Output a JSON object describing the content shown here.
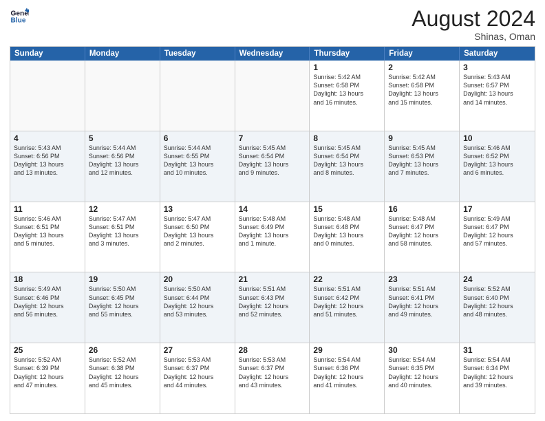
{
  "logo": {
    "line1": "General",
    "line2": "Blue"
  },
  "title": "August 2024",
  "subtitle": "Shinas, Oman",
  "days": [
    "Sunday",
    "Monday",
    "Tuesday",
    "Wednesday",
    "Thursday",
    "Friday",
    "Saturday"
  ],
  "weeks": [
    [
      {
        "day": "",
        "text": ""
      },
      {
        "day": "",
        "text": ""
      },
      {
        "day": "",
        "text": ""
      },
      {
        "day": "",
        "text": ""
      },
      {
        "day": "1",
        "text": "Sunrise: 5:42 AM\nSunset: 6:58 PM\nDaylight: 13 hours\nand 16 minutes."
      },
      {
        "day": "2",
        "text": "Sunrise: 5:42 AM\nSunset: 6:58 PM\nDaylight: 13 hours\nand 15 minutes."
      },
      {
        "day": "3",
        "text": "Sunrise: 5:43 AM\nSunset: 6:57 PM\nDaylight: 13 hours\nand 14 minutes."
      }
    ],
    [
      {
        "day": "4",
        "text": "Sunrise: 5:43 AM\nSunset: 6:56 PM\nDaylight: 13 hours\nand 13 minutes."
      },
      {
        "day": "5",
        "text": "Sunrise: 5:44 AM\nSunset: 6:56 PM\nDaylight: 13 hours\nand 12 minutes."
      },
      {
        "day": "6",
        "text": "Sunrise: 5:44 AM\nSunset: 6:55 PM\nDaylight: 13 hours\nand 10 minutes."
      },
      {
        "day": "7",
        "text": "Sunrise: 5:45 AM\nSunset: 6:54 PM\nDaylight: 13 hours\nand 9 minutes."
      },
      {
        "day": "8",
        "text": "Sunrise: 5:45 AM\nSunset: 6:54 PM\nDaylight: 13 hours\nand 8 minutes."
      },
      {
        "day": "9",
        "text": "Sunrise: 5:45 AM\nSunset: 6:53 PM\nDaylight: 13 hours\nand 7 minutes."
      },
      {
        "day": "10",
        "text": "Sunrise: 5:46 AM\nSunset: 6:52 PM\nDaylight: 13 hours\nand 6 minutes."
      }
    ],
    [
      {
        "day": "11",
        "text": "Sunrise: 5:46 AM\nSunset: 6:51 PM\nDaylight: 13 hours\nand 5 minutes."
      },
      {
        "day": "12",
        "text": "Sunrise: 5:47 AM\nSunset: 6:51 PM\nDaylight: 13 hours\nand 3 minutes."
      },
      {
        "day": "13",
        "text": "Sunrise: 5:47 AM\nSunset: 6:50 PM\nDaylight: 13 hours\nand 2 minutes."
      },
      {
        "day": "14",
        "text": "Sunrise: 5:48 AM\nSunset: 6:49 PM\nDaylight: 13 hours\nand 1 minute."
      },
      {
        "day": "15",
        "text": "Sunrise: 5:48 AM\nSunset: 6:48 PM\nDaylight: 13 hours\nand 0 minutes."
      },
      {
        "day": "16",
        "text": "Sunrise: 5:48 AM\nSunset: 6:47 PM\nDaylight: 12 hours\nand 58 minutes."
      },
      {
        "day": "17",
        "text": "Sunrise: 5:49 AM\nSunset: 6:47 PM\nDaylight: 12 hours\nand 57 minutes."
      }
    ],
    [
      {
        "day": "18",
        "text": "Sunrise: 5:49 AM\nSunset: 6:46 PM\nDaylight: 12 hours\nand 56 minutes."
      },
      {
        "day": "19",
        "text": "Sunrise: 5:50 AM\nSunset: 6:45 PM\nDaylight: 12 hours\nand 55 minutes."
      },
      {
        "day": "20",
        "text": "Sunrise: 5:50 AM\nSunset: 6:44 PM\nDaylight: 12 hours\nand 53 minutes."
      },
      {
        "day": "21",
        "text": "Sunrise: 5:51 AM\nSunset: 6:43 PM\nDaylight: 12 hours\nand 52 minutes."
      },
      {
        "day": "22",
        "text": "Sunrise: 5:51 AM\nSunset: 6:42 PM\nDaylight: 12 hours\nand 51 minutes."
      },
      {
        "day": "23",
        "text": "Sunrise: 5:51 AM\nSunset: 6:41 PM\nDaylight: 12 hours\nand 49 minutes."
      },
      {
        "day": "24",
        "text": "Sunrise: 5:52 AM\nSunset: 6:40 PM\nDaylight: 12 hours\nand 48 minutes."
      }
    ],
    [
      {
        "day": "25",
        "text": "Sunrise: 5:52 AM\nSunset: 6:39 PM\nDaylight: 12 hours\nand 47 minutes."
      },
      {
        "day": "26",
        "text": "Sunrise: 5:52 AM\nSunset: 6:38 PM\nDaylight: 12 hours\nand 45 minutes."
      },
      {
        "day": "27",
        "text": "Sunrise: 5:53 AM\nSunset: 6:37 PM\nDaylight: 12 hours\nand 44 minutes."
      },
      {
        "day": "28",
        "text": "Sunrise: 5:53 AM\nSunset: 6:37 PM\nDaylight: 12 hours\nand 43 minutes."
      },
      {
        "day": "29",
        "text": "Sunrise: 5:54 AM\nSunset: 6:36 PM\nDaylight: 12 hours\nand 41 minutes."
      },
      {
        "day": "30",
        "text": "Sunrise: 5:54 AM\nSunset: 6:35 PM\nDaylight: 12 hours\nand 40 minutes."
      },
      {
        "day": "31",
        "text": "Sunrise: 5:54 AM\nSunset: 6:34 PM\nDaylight: 12 hours\nand 39 minutes."
      }
    ]
  ]
}
